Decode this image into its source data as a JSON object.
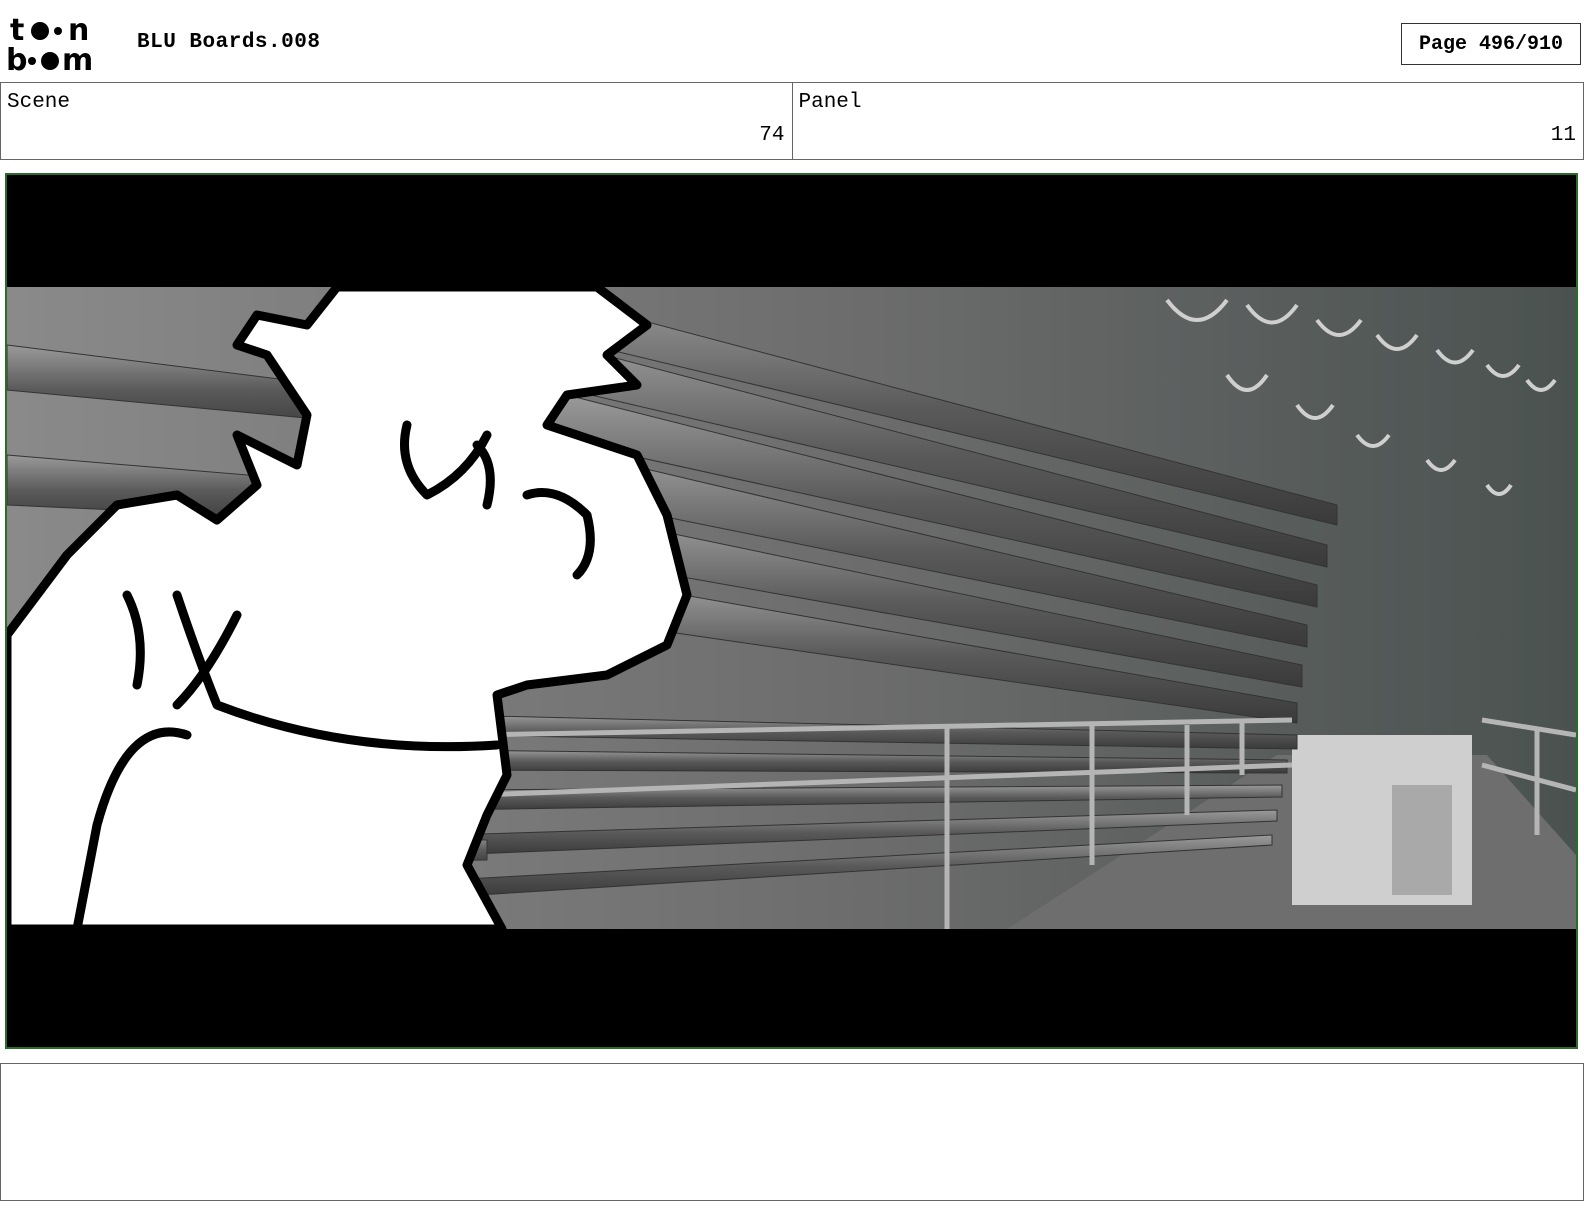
{
  "header": {
    "logo": {
      "icon": "toon-boom-logo",
      "text": "toon boom"
    },
    "title": "BLU Boards.008",
    "page_label": "Page 496/910"
  },
  "info": {
    "scene": {
      "label": "Scene",
      "value": "74"
    },
    "panel": {
      "label": "Panel",
      "value": "11"
    }
  },
  "panel_image": {
    "icon": "storyboard-panel-image",
    "colors": {
      "frame": "#2a6d2a",
      "letterbox": "#000000"
    }
  },
  "notes": {
    "text": ""
  }
}
